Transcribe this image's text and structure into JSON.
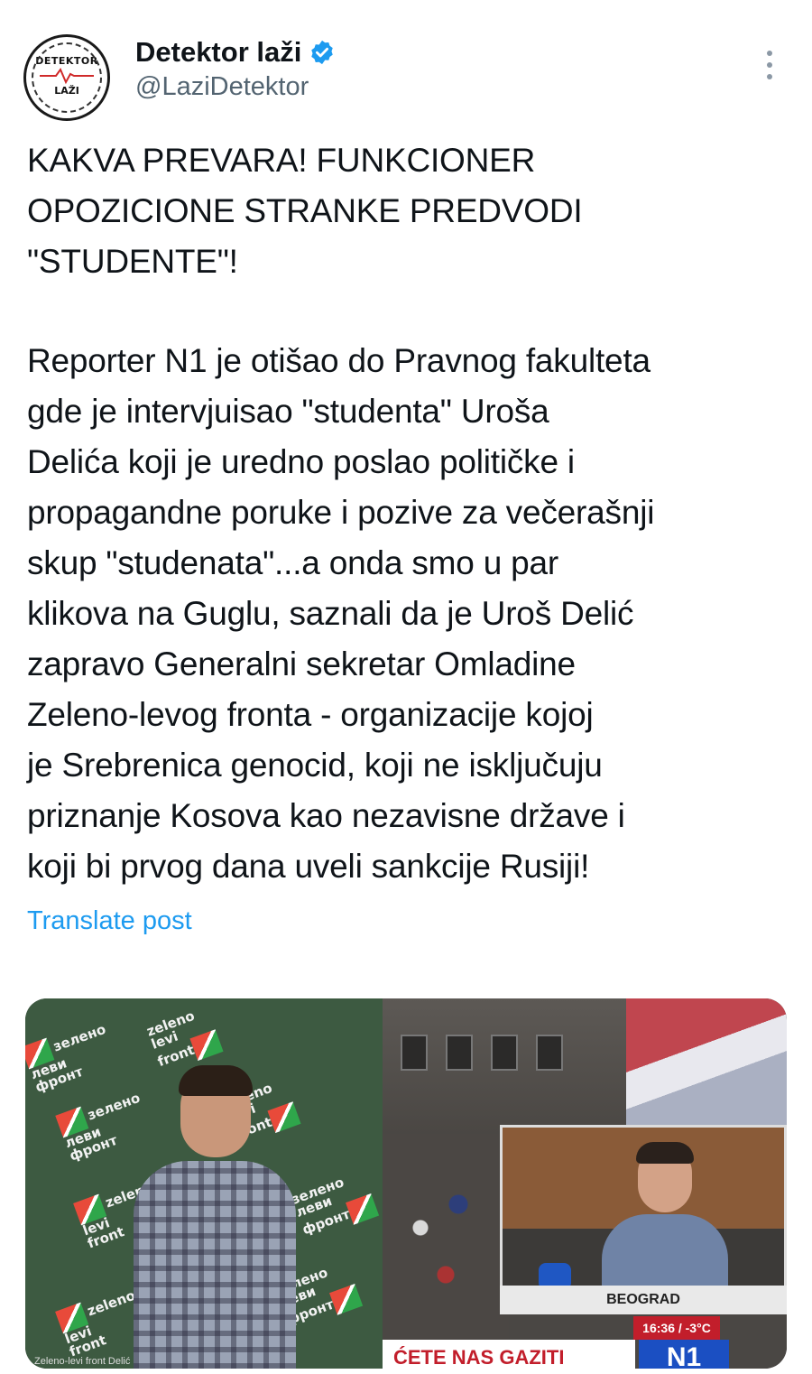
{
  "header": {
    "avatar_top": "DETEKTOR",
    "avatar_bottom": "LAŽI",
    "display_name": "Detektor laži",
    "handle": "@LaziDetektor",
    "verified_icon": "verified-badge-icon",
    "more_icon": "more-vertical-icon"
  },
  "tweet": {
    "headline": "KAKVA PREVARA! FUNKCIONER\nOPOZICIONE STRANKE PREDVODI\n\"STUDENTE\"!",
    "body": "Reporter N1 je otišao do Pravnog fakulteta\ngde je intervjuisao \"studenta\" Uroša\nDelića koji je uredno poslao političke i\npropagandne poruke i pozive za večerašnji\nskup \"studenata\"...a onda smo u par\nklikova na Guglu, saznali da je Uroš Delić\nzapravo Generalni sekretar Omladine\nZeleno-levog fronta - organizacije kojoj\nje Srebrenica genocid, koji ne isključuju\npriznanje Kosova kao nezavisne države i\nkoji bi prvog dana uveli sankcije Rusiji!",
    "translate_label": "Translate post"
  },
  "media": {
    "left_logos": [
      "зелено\nлеви\nфронт",
      "zeleno\nlevi\nfront",
      "зелено\nлеви\nфронт",
      "zeleno\nlevi\nfront",
      "zeleno\nlevi\nfront",
      "зелено\nлеви\nфронт",
      "zeleno\nlevi\nfront",
      "зелено\nлеви\nфронт"
    ],
    "left_caption": "Zeleno-levi front Delić",
    "right_location": "BEOGRAD",
    "right_time": "16:36 / -3°C",
    "right_ticker": "ĆETE NAS GAZITI",
    "right_logo": "N1"
  },
  "colors": {
    "link": "#1d9bf0",
    "handle": "#536471",
    "verified": "#1d9bf0",
    "text": "#0f1419"
  }
}
